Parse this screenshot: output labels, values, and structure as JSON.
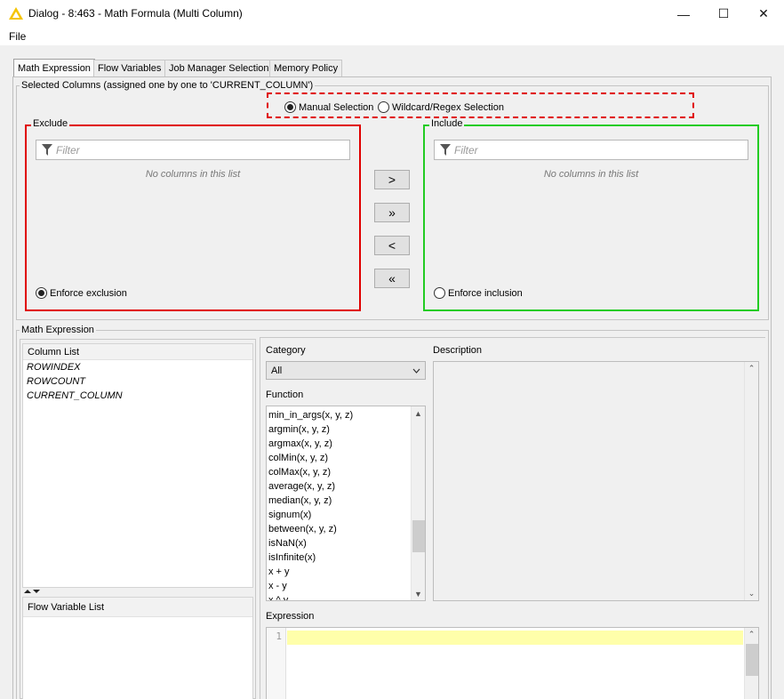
{
  "window": {
    "title": "Dialog - 8:463 - Math Formula (Multi Column)",
    "minimize": "—",
    "maximize": "☐",
    "close": "✕"
  },
  "menu": {
    "file": "File"
  },
  "tabs": [
    {
      "label": "Math Expression"
    },
    {
      "label": "Flow Variables"
    },
    {
      "label": "Job Manager Selection"
    },
    {
      "label": "Memory Policy"
    }
  ],
  "selected_columns": {
    "legend": "Selected Columns (assigned one by one to 'CURRENT_COLUMN')",
    "mode_manual": "Manual Selection",
    "mode_wildcard": "Wildcard/Regex Selection",
    "exclude": {
      "title": "Exclude",
      "filter_placeholder": "Filter",
      "empty": "No columns in this list",
      "enforce": "Enforce exclusion"
    },
    "include": {
      "title": "Include",
      "filter_placeholder": "Filter",
      "empty": "No columns in this list",
      "enforce": "Enforce inclusion"
    },
    "buttons": {
      "add": ">",
      "add_all": "»",
      "remove": "<",
      "remove_all": "«"
    }
  },
  "math_expression": {
    "legend": "Math Expression",
    "column_list": {
      "header": "Column List",
      "items": [
        "ROWINDEX",
        "ROWCOUNT",
        "CURRENT_COLUMN"
      ]
    },
    "flow_variable_list": {
      "header": "Flow Variable List"
    },
    "category": {
      "label": "Category",
      "value": "All"
    },
    "description": {
      "label": "Description"
    },
    "function": {
      "label": "Function",
      "items": [
        "min_in_args(x, y, z)",
        "argmin(x, y, z)",
        "argmax(x, y, z)",
        "colMin(x, y, z)",
        "colMax(x, y, z)",
        "average(x, y, z)",
        "median(x, y, z)",
        "signum(x)",
        "between(x, y, z)",
        "isNaN(x)",
        "isInfinite(x)",
        "x + y",
        "x - y",
        "x ^ y"
      ]
    },
    "expression": {
      "label": "Expression",
      "line_number": "1"
    }
  },
  "colors": {
    "exclude_border": "#e00000",
    "include_border": "#22cc22",
    "selection_border": "#e00000",
    "expression_line_highlight": "#ffffaa",
    "title_icon": "#f5c400"
  },
  "icons": {
    "app": "knime-warning-triangle-icon",
    "filter": "funnel-icon"
  }
}
